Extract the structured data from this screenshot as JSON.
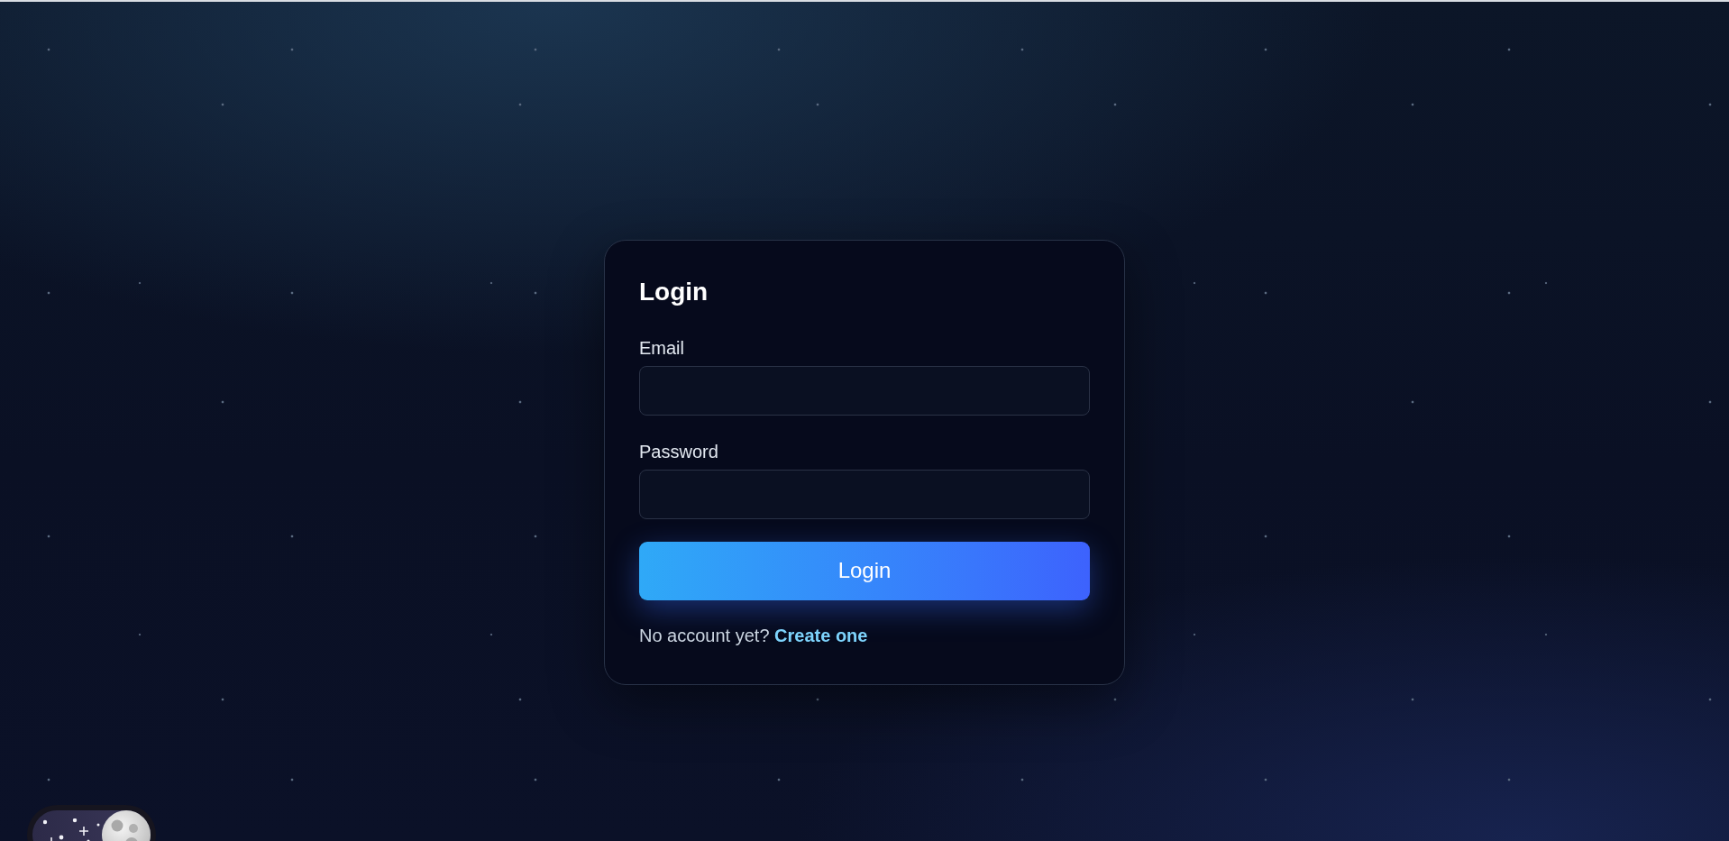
{
  "card": {
    "title": "Login",
    "fields": [
      {
        "label": "Email"
      },
      {
        "label": "Password"
      }
    ],
    "submit": "Login",
    "footer": {
      "text": "No account yet?",
      "link": "Create one"
    }
  },
  "theme_toggle": {
    "on": true
  }
}
